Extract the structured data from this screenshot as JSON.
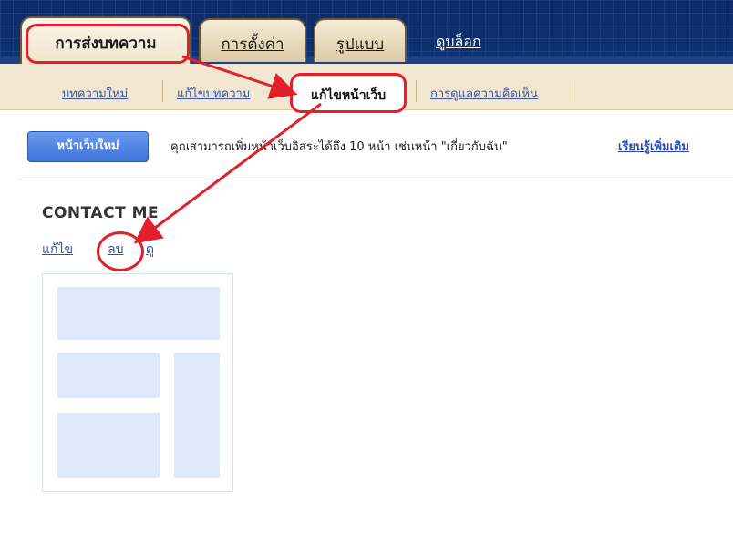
{
  "tabs": {
    "posting": "การส่งบทความ",
    "settings": "การตั้งค่า",
    "layout": "รูปแบบ",
    "view_blog": "ดูบล็อก"
  },
  "subnav": {
    "new_post": "บทความใหม่",
    "edit_posts": "แก้ไขบทความ",
    "edit_pages": "แก้ไขหน้าเว็บ",
    "moderate_comments": "การดูแลความคิดเห็น"
  },
  "toolbar": {
    "new_page_button": "หน้าเว็บใหม่",
    "info_text": "คุณสามารถเพิ่มหน้าเว็บอิสระได้ถึง 10 หน้า เช่นหน้า \"เกี่ยวกับฉัน\"",
    "learn_more": "เรียนรู้เพิ่มเติม"
  },
  "page": {
    "title": "CONTACT ME",
    "actions": {
      "edit": "แก้ไข",
      "delete": "ลบ",
      "view": "ดู"
    }
  },
  "colors": {
    "annotation": "#e0202a",
    "header": "#0d2d6b",
    "tab_bg": "#dccaa6",
    "subnav_bg": "#f1e6d0",
    "button": "#3e73d8",
    "link": "#2d4cb3",
    "thumbnail_block": "#dde8fa"
  }
}
